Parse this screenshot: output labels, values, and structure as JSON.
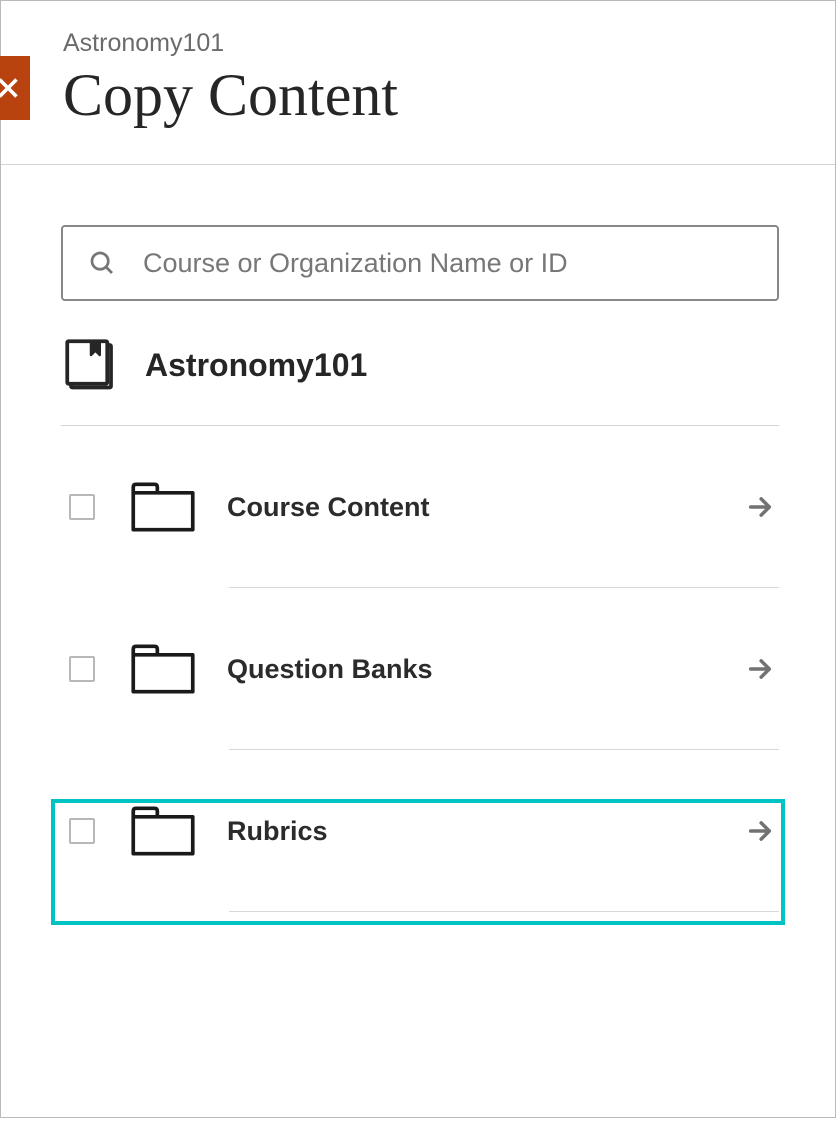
{
  "breadcrumb": "Astronomy101",
  "title": "Copy Content",
  "search": {
    "placeholder": "Course or Organization Name or ID"
  },
  "course": {
    "name": "Astronomy101"
  },
  "items": [
    {
      "label": "Course Content"
    },
    {
      "label": "Question Banks"
    },
    {
      "label": "Rubrics"
    }
  ]
}
